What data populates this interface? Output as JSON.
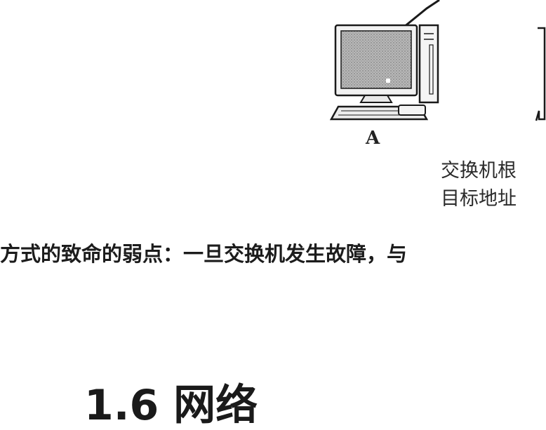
{
  "figure": {
    "computer_label": "A",
    "caption_line_1": "交换机根",
    "caption_line_2": "目标地址"
  },
  "body": {
    "text": "方式的致命的弱点：一旦交换机发生故障，与"
  },
  "section": {
    "heading": "1.6 网络"
  }
}
